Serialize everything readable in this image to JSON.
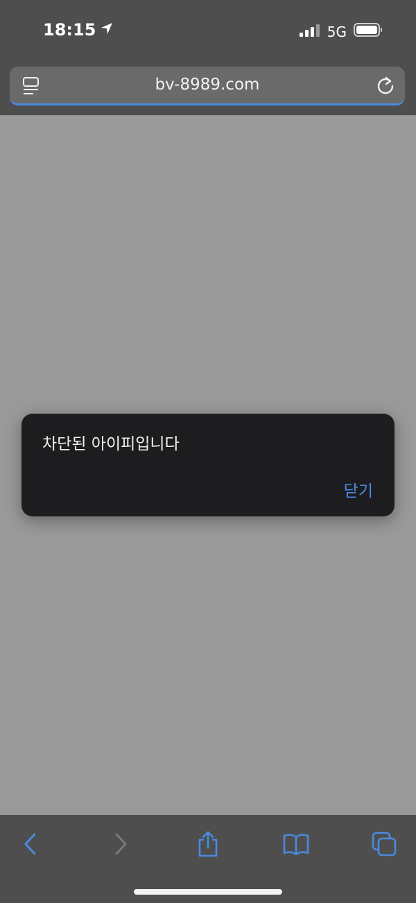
{
  "status": {
    "time": "18:15",
    "network": "5G"
  },
  "browser": {
    "url": "bv-8989.com"
  },
  "alert": {
    "message": "차단된 아이피입니다",
    "close_label": "닫기"
  },
  "colors": {
    "accent": "#4a8ae0",
    "chrome": "#4e4e4e",
    "dialog": "#1d1d20",
    "page_background": "#9a9a9a"
  },
  "icons": [
    "location-arrow-icon",
    "signal-icon",
    "battery-icon",
    "reader-icon",
    "reload-icon",
    "back-icon",
    "forward-icon",
    "share-icon",
    "bookmarks-icon",
    "tabs-icon"
  ]
}
